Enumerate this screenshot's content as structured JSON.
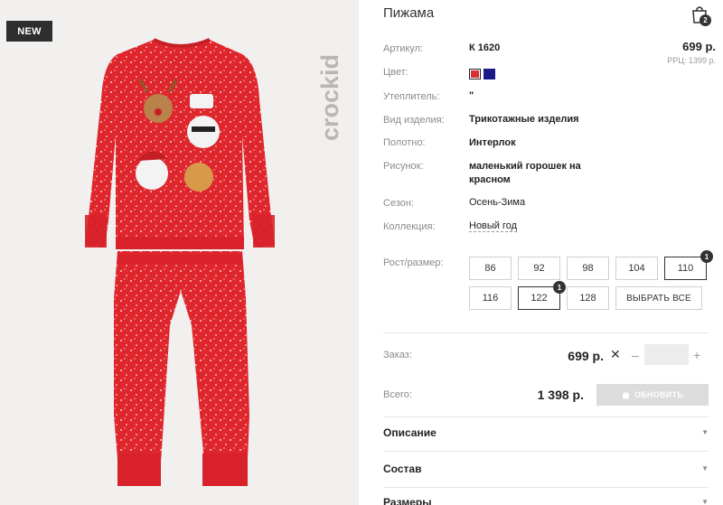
{
  "product": {
    "badge": "NEW",
    "brand": "crockid",
    "title": "Пижама",
    "cart_count": "2",
    "price": "699 р.",
    "rrp": "РРЦ: 1399 р."
  },
  "details": [
    {
      "label": "Артикул:",
      "value": "К 1620"
    },
    {
      "label": "Цвет:",
      "value": ""
    },
    {
      "label": "Утеплитель:",
      "value": "\""
    },
    {
      "label": "Вид изделия:",
      "value": "Трикотажные изделия"
    },
    {
      "label": "Полотно:",
      "value": "Интерлок"
    },
    {
      "label": "Рисунок:",
      "value": "маленький горошек на красном"
    },
    {
      "label": "Сезон:",
      "value": "Осень-Зима"
    },
    {
      "label": "Коллекция:",
      "value": "Новый год"
    }
  ],
  "colors": [
    {
      "name": "red",
      "hex": "#d63030",
      "selected": true
    },
    {
      "name": "navy",
      "hex": "#1a1a8a",
      "selected": false
    }
  ],
  "sizes": {
    "label": "Рост/размер:",
    "items": [
      "86",
      "92",
      "98",
      "104",
      "110",
      "116",
      "122",
      "128"
    ],
    "select_all": "ВЫБРАТЬ ВСЕ",
    "selected": [
      {
        "size": "110",
        "qty": "1"
      },
      {
        "size": "122",
        "qty": "1"
      }
    ]
  },
  "order": {
    "label": "Заказ:",
    "price": "699 р.",
    "remove": "✕",
    "minus": "–",
    "plus": "+",
    "qty_value": ""
  },
  "total": {
    "label": "Всего:",
    "value": "1 398 р.",
    "button": "ОБНОВИТЬ"
  },
  "accordion": [
    "Описание",
    "Состав",
    "Размеры"
  ],
  "accent_colors": {
    "garment": "#e0262d",
    "dark": "#2e2e2e"
  }
}
